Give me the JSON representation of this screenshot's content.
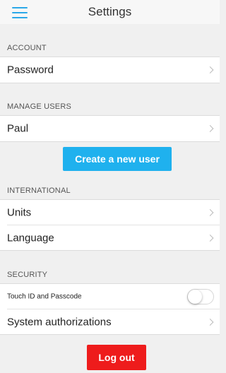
{
  "header": {
    "title": "Settings",
    "menu_icon": "hamburger-menu-icon",
    "accent_color": "#2ba8e8"
  },
  "account": {
    "section_title": "ACCOUNT",
    "password_label": "Password"
  },
  "manage_users": {
    "section_title": "MANAGE USERS",
    "users": [
      "Paul"
    ],
    "create_button_label": "Create a new user",
    "create_button_color": "#1fb1ee"
  },
  "international": {
    "section_title": "INTERNATIONAL",
    "units_label": "Units",
    "language_label": "Language"
  },
  "security": {
    "section_title": "SECURITY",
    "touch_id_label": "Touch ID and Passcode",
    "touch_id_enabled": false,
    "system_authorizations_label": "System authorizations"
  },
  "logout": {
    "label": "Log out",
    "color": "#ee1c1c"
  },
  "icons": {
    "row_chevron": "chevron-right-icon"
  }
}
